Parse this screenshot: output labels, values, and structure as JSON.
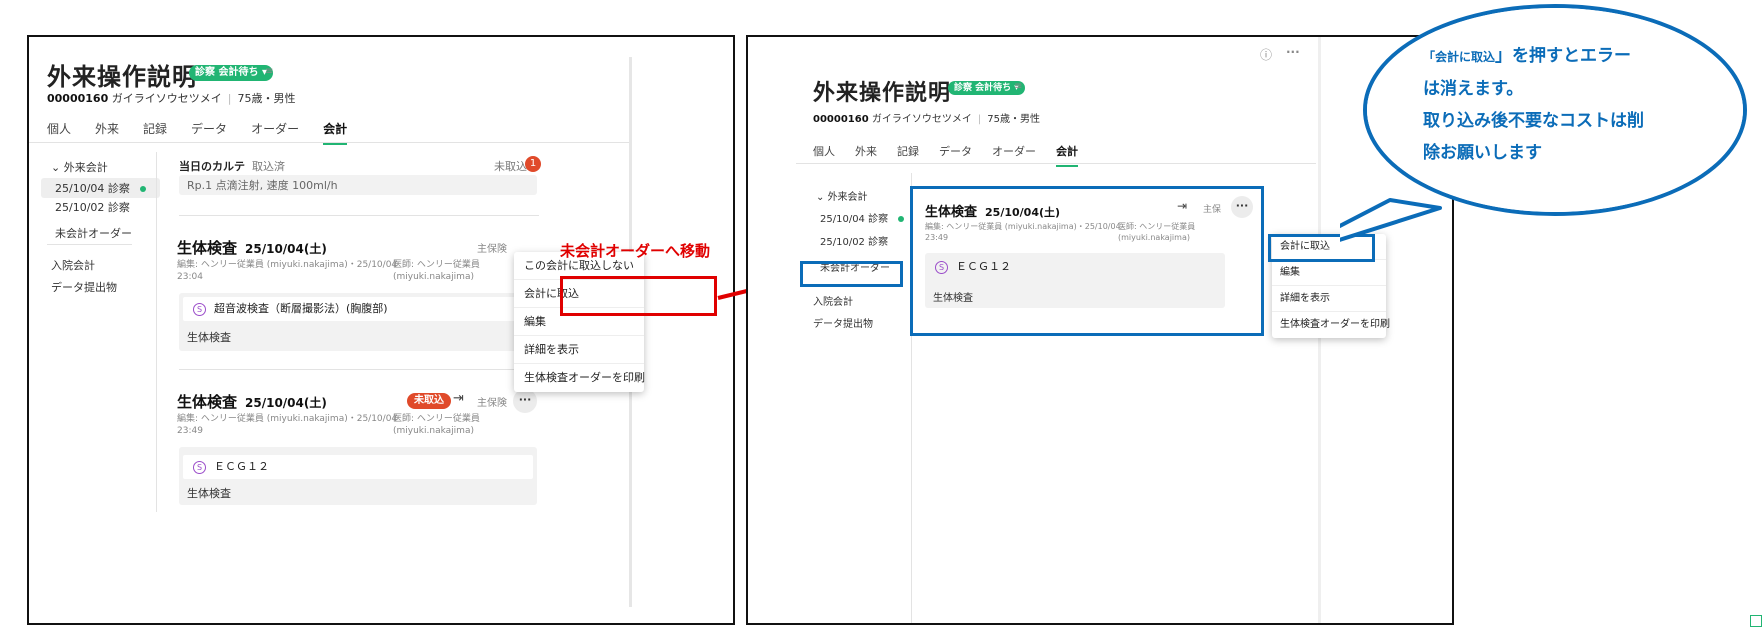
{
  "left": {
    "title": "外来操作説明",
    "status_badge": "診察 会計待ち ▾",
    "patient_id": "00000160",
    "patient_name": "ガイライソウセツメイ",
    "patient_age": "75歳・男性",
    "tabs": [
      "個人",
      "外来",
      "記録",
      "データ",
      "オーダー",
      "会計"
    ],
    "sidebar": {
      "group": "外来会計",
      "visits": [
        "25/10/04 診察",
        "25/10/02 診察"
      ],
      "items": [
        "未会計オーダー",
        "入院会計",
        "データ提出物"
      ]
    },
    "section_tabs": [
      "当日のカルテ",
      "取込済"
    ],
    "not_imported_label": "未取込",
    "not_imported_count": "1",
    "cut_text": "Rp.1 点滴注射, 速度 100ml/h",
    "cards": [
      {
        "title": "生体検査",
        "date": "25/10/04(土)",
        "editor": "編集: ヘンリー従業員 (miyuki.nakajima)・25/10/04",
        "edit_time": "23:04",
        "doctor": "医師: ヘンリー従業員",
        "doctor_id": "(miyuki.nakajima)",
        "insurance": "主保険",
        "item": "超音波検査（断層撮影法）(胸腹部)",
        "box_label": "生体検査"
      },
      {
        "title": "生体検査",
        "date": "25/10/04(土)",
        "editor": "編集: ヘンリー従業員 (miyuki.nakajima)・25/10/04",
        "edit_time": "23:49",
        "doctor": "医師: ヘンリー従業員",
        "doctor_id": "(miyuki.nakajima)",
        "badge": "未取込",
        "insurance": "主保険",
        "item": "ＥＣＧ１２",
        "box_label": "生体検査"
      }
    ],
    "menu": [
      "この会計に取込しない",
      "会計に取込",
      "編集",
      "詳細を表示",
      "生体検査オーダーを印刷"
    ],
    "annotation": "未会計オーダーへ移動"
  },
  "right": {
    "title": "外来操作説明",
    "status_badge": "診察 会計待ち ▾",
    "patient_id": "00000160",
    "patient_name": "ガイライソウセツメイ",
    "patient_age": "75歳・男性",
    "tabs": [
      "個人",
      "外来",
      "記録",
      "データ",
      "オーダー",
      "会計"
    ],
    "sidebar": {
      "group": "外来会計",
      "visits": [
        "25/10/04 診察",
        "25/10/02 診察"
      ],
      "items": [
        "未会計オーダー",
        "入院会計",
        "データ提出物"
      ]
    },
    "card": {
      "title": "生体検査",
      "date": "25/10/04(土)",
      "editor": "編集: ヘンリー従業員 (miyuki.nakajima)・25/10/04",
      "edit_time": "23:49",
      "doctor": "医師: ヘンリー従業員",
      "doctor_id": "(miyuki.nakajima)",
      "insurance": "主保",
      "item": "ＥＣＧ１２",
      "box_label": "生体検査"
    },
    "menu": [
      "会計に取込",
      "編集",
      "詳細を表示",
      "生体検査オーダーを印刷"
    ]
  },
  "callout": {
    "line1_open": "「",
    "line1_small": "会計に取込",
    "line1_rest": "」を押すとエラー",
    "line2": "は消えます。",
    "line3": "取り込み後不要なコストは削",
    "line4": "除お願いします"
  },
  "colors": {
    "accent_green": "#21b573",
    "alert_red": "#e04a2a",
    "annotation_red": "#e00000",
    "annotation_blue": "#0b6cb8"
  }
}
